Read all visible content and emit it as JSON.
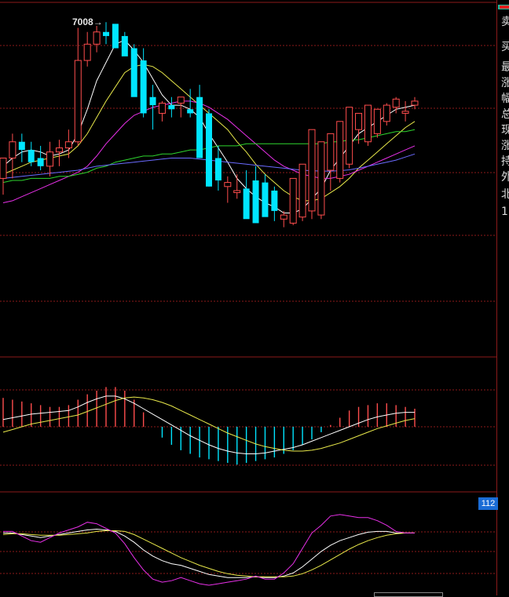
{
  "colors": {
    "background": "#000000",
    "grid": "#8b1a1a",
    "up": "#ff4d4d",
    "down": "#00e5ff",
    "ma5": "#ffffff",
    "ma10": "#e8e84a",
    "ma20": "#e830e8",
    "ma30": "#2ed52e",
    "ma60": "#6b6bff",
    "badge": "#1a6cd6"
  },
  "peak_label": "7008→",
  "badge_value": "112",
  "side_panel_labels": [
    "卖",
    "买",
    "最",
    "涨",
    "幅",
    "总",
    "现",
    "涨",
    "持",
    "外",
    "北",
    "1"
  ],
  "chart_data": [
    {
      "type": "candlestick",
      "panel": "price",
      "x": [
        1,
        2,
        3,
        4,
        5,
        6,
        7,
        8,
        9,
        10,
        11,
        12,
        13,
        14,
        15,
        16,
        17,
        18,
        19,
        20,
        21,
        22,
        23,
        24,
        25,
        26,
        27,
        28,
        29,
        30,
        31,
        32,
        33,
        34,
        35,
        36,
        37,
        38,
        39,
        40,
        41,
        42,
        43,
        44,
        45
      ],
      "open": [
        6240,
        6340,
        6420,
        6380,
        6340,
        6300,
        6370,
        6390,
        6420,
        6820,
        6900,
        6960,
        7000,
        6940,
        6880,
        6820,
        6640,
        6560,
        6600,
        6610,
        6580,
        6640,
        6560,
        6340,
        6200,
        6170,
        6190,
        6230,
        6220,
        6180,
        6040,
        6020,
        6050,
        6080,
        6060,
        6280,
        6240,
        6310,
        6480,
        6420,
        6460,
        6520,
        6590,
        6560,
        6600
      ],
      "high": [
        6340,
        6460,
        6460,
        6420,
        6400,
        6420,
        6430,
        6480,
        6980,
        6960,
        6990,
        7008,
        6990,
        6960,
        6900,
        6880,
        6700,
        6620,
        6640,
        6640,
        6680,
        6700,
        6580,
        6400,
        6250,
        6260,
        6280,
        6300,
        6260,
        6200,
        6080,
        6070,
        6080,
        6120,
        6100,
        6300,
        6340,
        6440,
        6530,
        6510,
        6560,
        6610,
        6640,
        6620,
        6640
      ],
      "low": [
        6160,
        6240,
        6320,
        6300,
        6280,
        6250,
        6300,
        6340,
        6400,
        6790,
        6860,
        6900,
        6880,
        6860,
        6700,
        6540,
        6480,
        6520,
        6540,
        6540,
        6540,
        6420,
        6200,
        6180,
        6120,
        6140,
        6160,
        6200,
        6140,
        6030,
        6000,
        6010,
        6030,
        6040,
        6040,
        6180,
        6220,
        6290,
        6410,
        6400,
        6440,
        6500,
        6560,
        6520,
        6580
      ],
      "close": [
        6340,
        6420,
        6380,
        6320,
        6300,
        6370,
        6390,
        6420,
        6820,
        6900,
        6960,
        6940,
        6880,
        6840,
        6640,
        6560,
        6600,
        6610,
        6580,
        6640,
        6560,
        6340,
        6200,
        6230,
        6220,
        6180,
        6040,
        6020,
        6050,
        6080,
        6060,
        6240,
        6310,
        6480,
        6420,
        6460,
        6520,
        6590,
        6560,
        6600,
        6580,
        6600,
        6630,
        6570,
        6620
      ]
    },
    {
      "type": "line",
      "panel": "price",
      "series": [
        {
          "values": [
            6300,
            6340,
            6370,
            6380,
            6370,
            6350,
            6360,
            6380,
            6460,
            6580,
            6720,
            6810,
            6900,
            6920,
            6870,
            6810,
            6730,
            6650,
            6600,
            6600,
            6580,
            6540,
            6460,
            6390,
            6320,
            6240,
            6190,
            6150,
            6120,
            6100,
            6070,
            6070,
            6090,
            6140,
            6190,
            6280,
            6340,
            6400,
            6460,
            6490,
            6520,
            6550,
            6580,
            6590,
            6600
          ]
        },
        {
          "values": [
            6260,
            6280,
            6300,
            6320,
            6330,
            6340,
            6350,
            6360,
            6400,
            6460,
            6540,
            6620,
            6690,
            6760,
            6790,
            6800,
            6790,
            6760,
            6720,
            6680,
            6640,
            6600,
            6560,
            6520,
            6480,
            6420,
            6370,
            6310,
            6260,
            6220,
            6180,
            6150,
            6130,
            6130,
            6140,
            6170,
            6200,
            6240,
            6290,
            6330,
            6370,
            6410,
            6450,
            6490,
            6520
          ]
        },
        {
          "values": [
            6120,
            6130,
            6150,
            6170,
            6190,
            6210,
            6230,
            6250,
            6270,
            6300,
            6350,
            6410,
            6460,
            6510,
            6550,
            6570,
            6590,
            6600,
            6610,
            6620,
            6620,
            6610,
            6590,
            6560,
            6530,
            6490,
            6450,
            6410,
            6370,
            6330,
            6300,
            6280,
            6260,
            6250,
            6240,
            6240,
            6250,
            6260,
            6280,
            6300,
            6320,
            6340,
            6360,
            6380,
            6400
          ]
        },
        {
          "values": [
            6220,
            6230,
            6230,
            6240,
            6240,
            6240,
            6250,
            6250,
            6260,
            6270,
            6290,
            6300,
            6320,
            6330,
            6340,
            6350,
            6350,
            6360,
            6360,
            6370,
            6380,
            6380,
            6390,
            6400,
            6400,
            6400,
            6410,
            6410,
            6410,
            6410,
            6410,
            6410,
            6410,
            6410,
            6410,
            6420,
            6420,
            6430,
            6430,
            6440,
            6450,
            6460,
            6470,
            6470,
            6480
          ]
        },
        {
          "values": [
            6240,
            6245,
            6250,
            6255,
            6260,
            6265,
            6270,
            6275,
            6280,
            6290,
            6300,
            6305,
            6310,
            6315,
            6320,
            6325,
            6330,
            6335,
            6340,
            6340,
            6340,
            6335,
            6330,
            6325,
            6320,
            6315,
            6310,
            6305,
            6300,
            6295,
            6290,
            6285,
            6280,
            6278,
            6276,
            6276,
            6278,
            6282,
            6290,
            6300,
            6310,
            6320,
            6330,
            6345,
            6360
          ]
        }
      ]
    },
    {
      "type": "bar",
      "panel": "macd",
      "x": [
        1,
        2,
        3,
        4,
        5,
        6,
        7,
        8,
        9,
        10,
        11,
        12,
        13,
        14,
        15,
        16,
        17,
        18,
        19,
        20,
        21,
        22,
        23,
        24,
        25,
        26,
        27,
        28,
        29,
        30,
        31,
        32,
        33,
        34,
        35,
        36,
        37,
        38,
        39,
        40,
        41,
        42,
        43,
        44,
        45
      ],
      "values": [
        32,
        30,
        28,
        26,
        24,
        22,
        22,
        24,
        30,
        36,
        40,
        44,
        44,
        40,
        30,
        16,
        0,
        -12,
        -20,
        -26,
        -30,
        -34,
        -36,
        -38,
        -40,
        -42,
        -40,
        -38,
        -36,
        -34,
        -30,
        -26,
        -20,
        -14,
        -6,
        2,
        10,
        18,
        22,
        24,
        26,
        26,
        24,
        22,
        20
      ],
      "series": [
        {
          "values": [
            8,
            10,
            12,
            14,
            15,
            16,
            17,
            18,
            22,
            27,
            31,
            34,
            34,
            31,
            26,
            20,
            14,
            8,
            2,
            -4,
            -10,
            -15,
            -20,
            -24,
            -27,
            -29,
            -30,
            -30,
            -29,
            -27,
            -25,
            -23,
            -20,
            -16,
            -12,
            -8,
            -4,
            0,
            4,
            8,
            11,
            13,
            15,
            16,
            16
          ]
        },
        {
          "values": [
            -6,
            -3,
            0,
            3,
            5,
            7,
            9,
            11,
            13,
            17,
            21,
            25,
            29,
            32,
            33,
            32,
            30,
            27,
            23,
            18,
            13,
            8,
            3,
            -2,
            -7,
            -11,
            -15,
            -19,
            -22,
            -24,
            -26,
            -27,
            -27,
            -26,
            -24,
            -21,
            -18,
            -14,
            -10,
            -6,
            -2,
            1,
            4,
            7,
            9
          ]
        }
      ]
    },
    {
      "type": "line",
      "panel": "kdj",
      "x": [
        1,
        2,
        3,
        4,
        5,
        6,
        7,
        8,
        9,
        10,
        11,
        12,
        13,
        14,
        15,
        16,
        17,
        18,
        19,
        20,
        21,
        22,
        23,
        24,
        25,
        26,
        27,
        28,
        29,
        30,
        31,
        32,
        33,
        34,
        35,
        36,
        37,
        38,
        39,
        40,
        41,
        42,
        43,
        44,
        45
      ],
      "series": [
        {
          "values": [
            70,
            70,
            68,
            66,
            64,
            66,
            68,
            70,
            72,
            74,
            75,
            74,
            72,
            66,
            58,
            48,
            40,
            34,
            30,
            28,
            24,
            20,
            16,
            14,
            12,
            12,
            12,
            13,
            12,
            12,
            14,
            18,
            26,
            36,
            46,
            54,
            60,
            64,
            68,
            71,
            72,
            72,
            70,
            70,
            70
          ]
        },
        {
          "values": [
            68,
            69,
            69,
            68,
            67,
            67,
            67,
            68,
            69,
            70,
            72,
            73,
            73,
            72,
            68,
            62,
            56,
            50,
            44,
            38,
            33,
            28,
            24,
            20,
            17,
            15,
            14,
            13,
            13,
            13,
            13,
            14,
            17,
            22,
            28,
            35,
            42,
            49,
            55,
            60,
            64,
            67,
            69,
            70,
            70
          ]
        },
        {
          "values": [
            72,
            72,
            66,
            60,
            58,
            64,
            70,
            74,
            78,
            84,
            82,
            76,
            70,
            56,
            38,
            22,
            10,
            6,
            8,
            12,
            8,
            4,
            2,
            4,
            6,
            8,
            10,
            14,
            10,
            10,
            18,
            30,
            50,
            70,
            80,
            92,
            94,
            92,
            90,
            90,
            86,
            80,
            72,
            70,
            70
          ]
        }
      ]
    }
  ]
}
